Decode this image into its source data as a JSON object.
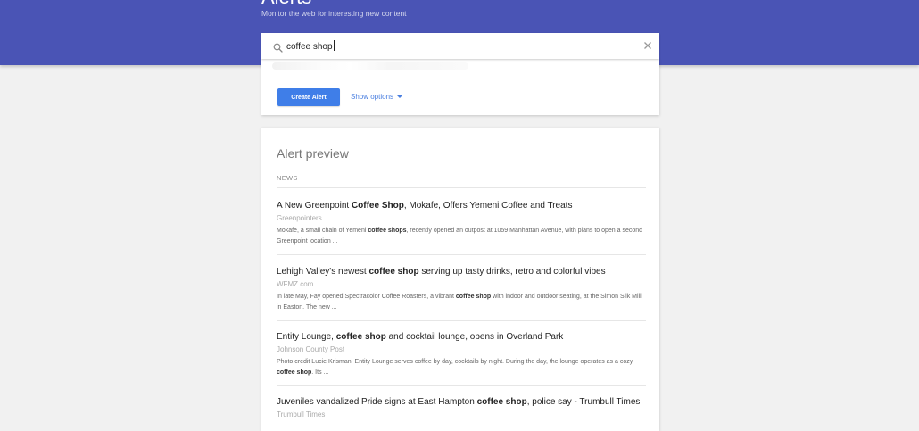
{
  "header": {
    "title": "Alerts",
    "subtitle": "Monitor the web for interesting new content"
  },
  "search": {
    "query": "coffee shop",
    "icon": "search-icon",
    "clear_icon": "close-icon"
  },
  "options": {
    "create_label": "Create Alert",
    "show_options_label": "Show options"
  },
  "preview": {
    "title": "Alert preview",
    "section": "NEWS",
    "items": [
      {
        "headline": [
          {
            "t": "A New Greenpoint ",
            "b": false
          },
          {
            "t": "Coffee Shop",
            "b": true
          },
          {
            "t": ", Mokafe, Offers Yemeni Coffee and Treats",
            "b": false
          }
        ],
        "source": "Greenpointers",
        "snippet": [
          {
            "t": "Mokafe, a small chain of Yemeni ",
            "b": false
          },
          {
            "t": "coffee shops",
            "b": true
          },
          {
            "t": ", recently opened an outpost at 1059 Manhattan Avenue, with plans to open a second Greenpoint location ...",
            "b": false
          }
        ]
      },
      {
        "headline": [
          {
            "t": "Lehigh Valley's newest ",
            "b": false
          },
          {
            "t": "coffee shop",
            "b": true
          },
          {
            "t": " serving up tasty drinks, retro and colorful vibes",
            "b": false
          }
        ],
        "source": "WFMZ.com",
        "snippet": [
          {
            "t": "In late May, Fay opened Spectracolor Coffee Roasters, a vibrant ",
            "b": false
          },
          {
            "t": "coffee shop",
            "b": true
          },
          {
            "t": " with indoor and outdoor seating, at the Simon Silk Mill in Easton. The new ...",
            "b": false
          }
        ]
      },
      {
        "headline": [
          {
            "t": "Entity Lounge, ",
            "b": false
          },
          {
            "t": "coffee shop",
            "b": true
          },
          {
            "t": " and cocktail lounge, opens in Overland Park",
            "b": false
          }
        ],
        "source": "Johnson County Post",
        "snippet": [
          {
            "t": "Photo credit Lucie Krisman. Entity Lounge serves coffee by day, cocktails by night. During the day, the lounge operates as a cozy ",
            "b": false
          },
          {
            "t": "coffee shop",
            "b": true
          },
          {
            "t": ". Its ...",
            "b": false
          }
        ]
      },
      {
        "headline": [
          {
            "t": "Juveniles vandalized Pride signs at East Hampton ",
            "b": false
          },
          {
            "t": "coffee shop",
            "b": true
          },
          {
            "t": ", police say - Trumbull Times",
            "b": false
          }
        ],
        "source": "Trumbull Times",
        "snippet": []
      }
    ]
  },
  "colors": {
    "header_bg": "#4a54b5",
    "button_bg": "#3f7ee8",
    "link": "#4a7fe0"
  }
}
